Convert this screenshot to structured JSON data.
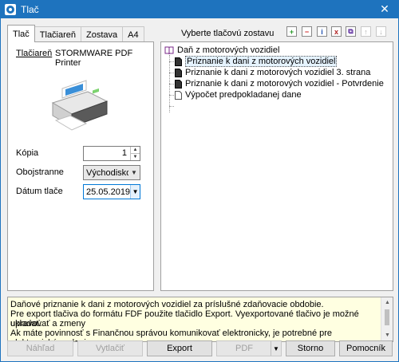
{
  "window": {
    "title": "Tlač"
  },
  "tabs": [
    "Tlač",
    "Tlačiareň",
    "Zostava",
    "A4"
  ],
  "printer": {
    "label": "Tlačiareň",
    "name": "STORMWARE PDF Printer"
  },
  "fields": {
    "copies": {
      "label": "Kópia",
      "value": "1"
    },
    "duplex": {
      "label": "Obojstranne",
      "value": "Východiskové"
    },
    "print_date": {
      "label": "Dátum tlače",
      "value": "25.05.2019"
    }
  },
  "reports": {
    "caption": "Vyberte tlačovú zostavu",
    "root": "Daň z motorových vozidiel",
    "items": [
      "Priznanie k dani z motorových vozidiel",
      "Priznanie k dani z motorových vozidiel 3. strana",
      "Priznanie k dani z motorových vozidiel - Potvrdenie",
      "Výpočet predpokladanej dane"
    ],
    "selected_index": 0,
    "toolbar_icons": [
      "add-icon",
      "remove-icon",
      "info-icon",
      "document-x-icon",
      "copy-icon",
      "move-up-icon",
      "move-down-icon"
    ]
  },
  "info_lines": [
    "Daňové priznanie k dani z motorových vozidiel za príslušné zdaňovacie obdobie.",
    "Pre export tlačiva do formátu FDF použite tlačidlo Export. Vyexportované tlačivo je možné upravovať a zmeny",
    "ukladať.",
    "Ak máte povinnosť s Finančnou správou komunikovať elektronicky, je potrebné pre elektronické podanie"
  ],
  "buttons": {
    "preview": "Náhľad",
    "print": "Vytlačiť",
    "export": "Export",
    "pdf": "PDF",
    "cancel": "Storno",
    "help": "Pomocník"
  },
  "colors": {
    "titlebar": "#1e73be",
    "info_bg": "#ffffe1",
    "selection": "#e5f3ff"
  }
}
